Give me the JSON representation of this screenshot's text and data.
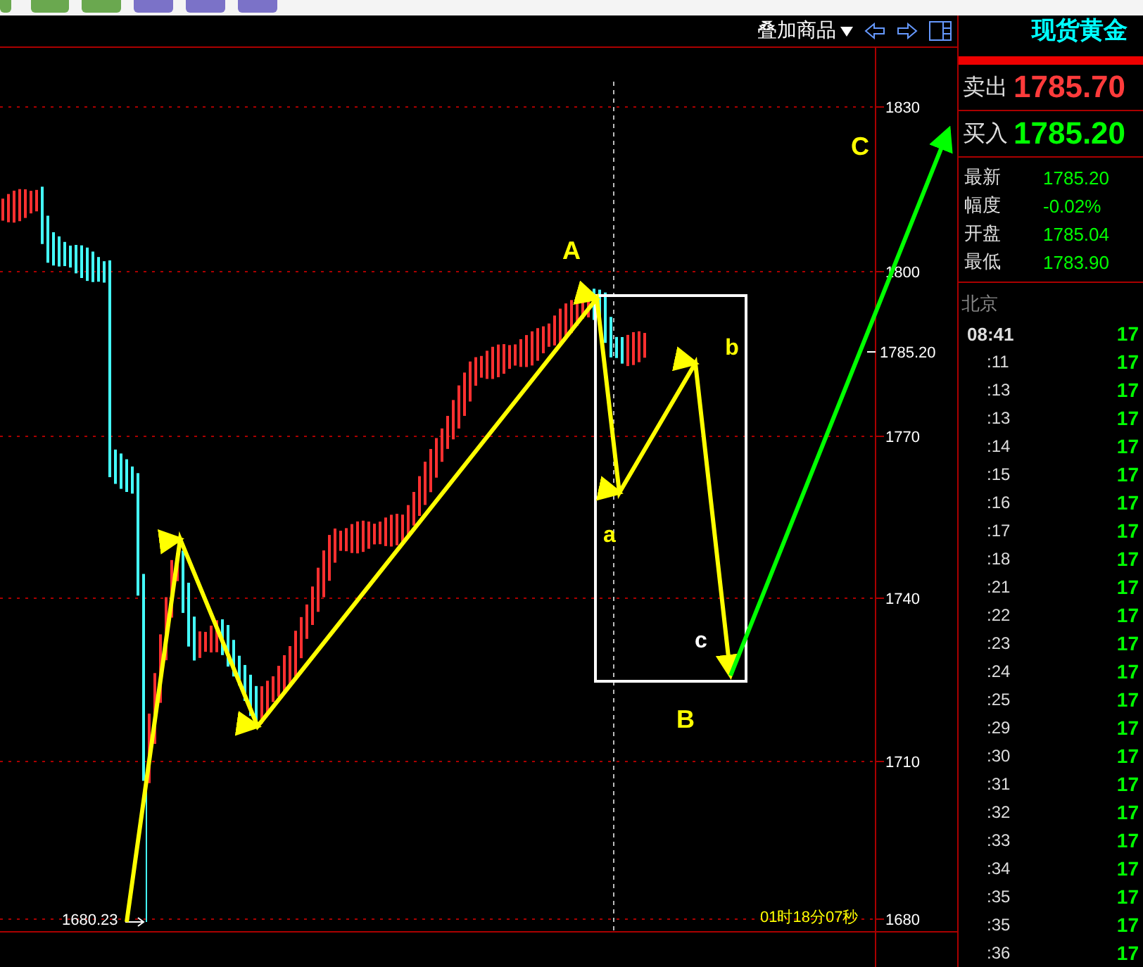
{
  "chart_header": {
    "overlay_menu": "叠加商品"
  },
  "price_axis": [
    "1830",
    "1800",
    "1770",
    "1740",
    "1710",
    "1680"
  ],
  "current_price_tag": "1785.20",
  "low_label": "1680.23",
  "countdown": "01时18分07秒",
  "wave_labels": [
    {
      "text": "A",
      "kind": "major"
    },
    {
      "text": "a",
      "kind": "minor"
    },
    {
      "text": "b",
      "kind": "minor"
    },
    {
      "text": "c",
      "kind": "minor"
    },
    {
      "text": "B",
      "kind": "major"
    },
    {
      "text": "C",
      "kind": "major"
    }
  ],
  "quote_panel": {
    "title": "现货黄金",
    "sell": {
      "label": "卖出",
      "price": "1785.70"
    },
    "buy": {
      "label": "买入",
      "price": "1785.20"
    },
    "stats": [
      {
        "label": "最新",
        "value": "1785.20"
      },
      {
        "label": "幅度",
        "value": "-0.02%"
      },
      {
        "label": "开盘",
        "value": "1785.04"
      },
      {
        "label": "最低",
        "value": "1783.90"
      }
    ],
    "city": "北京",
    "ticks": [
      {
        "time": "08:41",
        "price": "17"
      },
      {
        "time": ":11",
        "price": "17"
      },
      {
        "time": ":13",
        "price": "17"
      },
      {
        "time": ":13",
        "price": "17"
      },
      {
        "time": ":14",
        "price": "17"
      },
      {
        "time": ":15",
        "price": "17"
      },
      {
        "time": ":16",
        "price": "17"
      },
      {
        "time": ":17",
        "price": "17"
      },
      {
        "time": ":18",
        "price": "17"
      },
      {
        "time": ":21",
        "price": "17"
      },
      {
        "time": ":22",
        "price": "17"
      },
      {
        "time": ":23",
        "price": "17"
      },
      {
        "time": ":24",
        "price": "17"
      },
      {
        "time": ":25",
        "price": "17"
      },
      {
        "time": ":29",
        "price": "17"
      },
      {
        "time": ":30",
        "price": "17"
      },
      {
        "time": ":31",
        "price": "17"
      },
      {
        "time": ":32",
        "price": "17"
      },
      {
        "time": ":33",
        "price": "17"
      },
      {
        "time": ":34",
        "price": "17"
      },
      {
        "time": ":35",
        "price": "17"
      },
      {
        "time": ":35",
        "price": "17"
      },
      {
        "time": ":36",
        "price": "17"
      }
    ]
  }
}
